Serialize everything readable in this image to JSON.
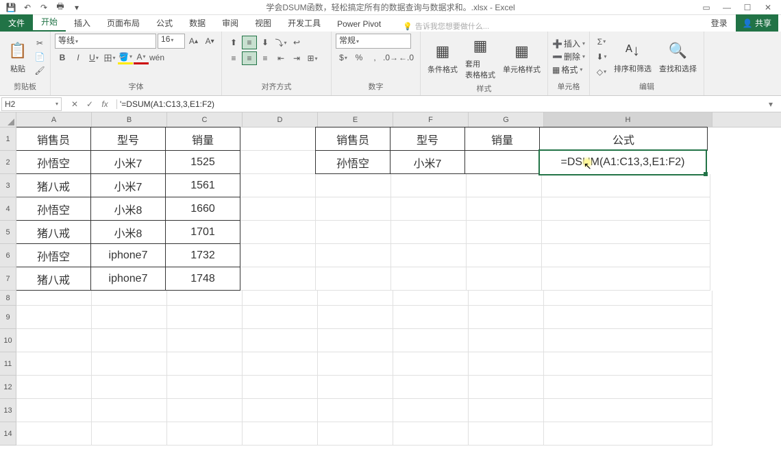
{
  "title": "学会DSUM函数，轻松搞定所有的数据查询与数据求和。.xlsx - Excel",
  "qat": {
    "save": "💾",
    "undo": "↶",
    "redo": "↷",
    "print": "🖶",
    "more": "▾"
  },
  "win": {
    "help": "?",
    "opts": "▭",
    "min": "—",
    "max": "☐",
    "close": "✕"
  },
  "tabs": {
    "file": "文件",
    "home": "开始",
    "insert": "插入",
    "layout": "页面布局",
    "formula": "公式",
    "data": "数据",
    "review": "审阅",
    "view": "视图",
    "dev": "开发工具",
    "powerpivot": "Power Pivot"
  },
  "tellme": "告诉我您想要做什么...",
  "account": "登录",
  "share": "共享",
  "ribbon": {
    "clipboard": {
      "label": "剪贴板",
      "paste": "粘贴"
    },
    "font": {
      "label": "字体",
      "name": "等线",
      "size": "16"
    },
    "align": {
      "label": "对齐方式"
    },
    "number": {
      "label": "数字",
      "format": "常规"
    },
    "styles": {
      "label": "样式",
      "cond": "条件格式",
      "table": "套用\n表格格式",
      "cell": "单元格样式"
    },
    "cells": {
      "label": "单元格",
      "insert": "插入",
      "delete": "删除",
      "format": "格式"
    },
    "edit": {
      "label": "编辑",
      "sort": "排序和筛选",
      "find": "查找和选择"
    }
  },
  "namebox": "H2",
  "formula": "'=DSUM(A1:C13,3,E1:F2)",
  "columns": [
    "A",
    "B",
    "C",
    "D",
    "E",
    "F",
    "G",
    "H"
  ],
  "rownums": [
    "1",
    "2",
    "3",
    "4",
    "5",
    "6",
    "7",
    "8",
    "9",
    "10",
    "11",
    "12",
    "13",
    "14"
  ],
  "data": {
    "r1": {
      "A": "销售员",
      "B": "型号",
      "C": "销量",
      "E": "销售员",
      "F": "型号",
      "G": "销量",
      "H": "公式"
    },
    "r2": {
      "A": "孙悟空",
      "B": "小米7",
      "C": "1525",
      "E": "孙悟空",
      "F": "小米7",
      "H": "=DSUM(A1:C13,3,E1:F2)"
    },
    "r3": {
      "A": "猪八戒",
      "B": "小米7",
      "C": "1561"
    },
    "r4": {
      "A": "孙悟空",
      "B": "小米8",
      "C": "1660"
    },
    "r5": {
      "A": "猪八戒",
      "B": "小米8",
      "C": "1701"
    },
    "r6": {
      "A": "孙悟空",
      "B": "iphone7",
      "C": "1732"
    },
    "r7": {
      "A": "猪八戒",
      "B": "iphone7",
      "C": "1748"
    }
  }
}
